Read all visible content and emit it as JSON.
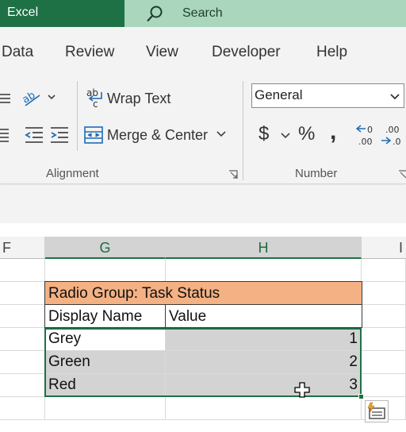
{
  "app": {
    "title": "Excel"
  },
  "search": {
    "placeholder": "Search"
  },
  "tabs": [
    "Data",
    "Review",
    "View",
    "Developer",
    "Help"
  ],
  "ribbon": {
    "alignment": {
      "wrap_text": "Wrap Text",
      "merge_center": "Merge & Center",
      "group_label": "Alignment"
    },
    "number": {
      "format": "General",
      "currency_symbol": "$",
      "percent_symbol": "%",
      "comma_symbol": ",",
      "group_label": "Number"
    }
  },
  "columns": [
    "F",
    "G",
    "H",
    "I"
  ],
  "sheet": {
    "title_row": "Radio Group: Task Status",
    "headers": [
      "Display Name",
      "Value"
    ],
    "rows": [
      {
        "name": "Grey",
        "value": "1"
      },
      {
        "name": "Green",
        "value": "2"
      },
      {
        "name": "Red",
        "value": "3"
      }
    ]
  },
  "colors": {
    "accent": "#1e7145",
    "header_fill": "#f4b183",
    "selection_fill": "#d3d3d3"
  }
}
